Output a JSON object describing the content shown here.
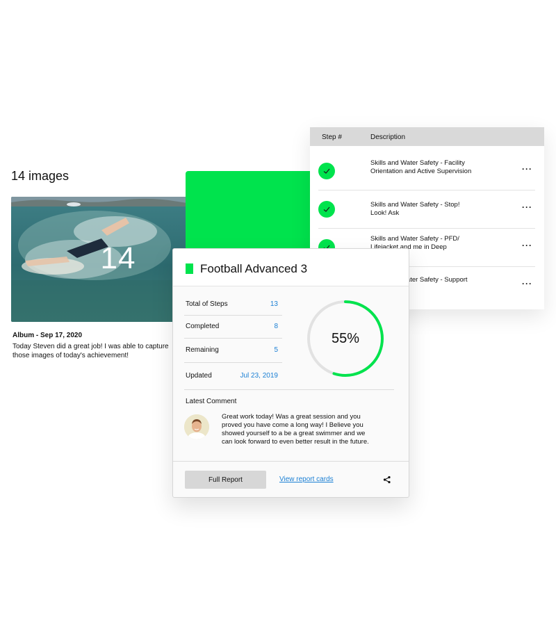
{
  "album": {
    "title": "14 images",
    "count": "14",
    "date": "Album - Sep 17, 2020",
    "caption": "Today Steven did a great job! I was able to capture those images of today's achievement!"
  },
  "steps": {
    "header": {
      "step": "Step #",
      "description": "Description"
    },
    "rows": [
      {
        "description": "Skills and Water Safety - Facility Orientation and Active Supervision",
        "completed": true,
        "menu": "···"
      },
      {
        "description": "Skills and Water Safety - Stop! Look! Ask",
        "completed": true,
        "menu": "···"
      },
      {
        "description": "Skills and Water Safety - PFD/ Lifejacket and me in Deep",
        "completed": true,
        "menu": "···"
      },
      {
        "description": "Skills and Water Safety - Support 10 sec",
        "completed": false,
        "menu": "···"
      }
    ]
  },
  "card": {
    "title": "Football Advanced 3",
    "stats": [
      {
        "label": "Total of Steps",
        "value": "13"
      },
      {
        "label": "Completed",
        "value": "8"
      },
      {
        "label": "Remaining",
        "value": "5"
      },
      {
        "label": "Updated",
        "value": "Jul 23, 2019"
      }
    ],
    "progress": {
      "percent": 55,
      "label": "55%"
    },
    "comment": {
      "label": "Latest Comment",
      "text": "Great work today! Was a great session and you proved you have come a long way! I Believe you showed yourself to a be a great swimmer and we can look forward to even better result in the future."
    },
    "footer": {
      "full_report": "Full Report",
      "view_cards": "View report cards"
    }
  },
  "colors": {
    "accent_green": "#00e34d",
    "link_blue": "#1a7fd4",
    "header_gray": "#d9d9d9"
  },
  "icons": [
    "check-icon",
    "more-icon",
    "share-icon"
  ]
}
